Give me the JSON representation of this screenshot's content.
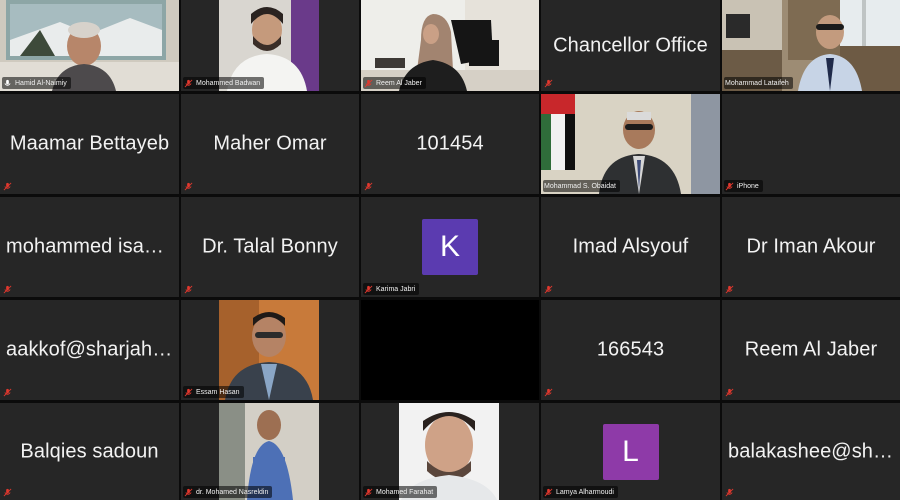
{
  "colors": {
    "tile_bg": "#262626",
    "active_border": "#b5d66a",
    "muted_mic": "#e0382e",
    "avatar_k": "#5b3bb0",
    "avatar_l": "#8e3aa8"
  },
  "tiles": [
    {
      "id": "hamid",
      "name": "Hamid Al-Naimiy",
      "type": "video",
      "mic": "on",
      "active": true
    },
    {
      "id": "badwan",
      "name": "Mohammed Badwan",
      "type": "video",
      "mic": "muted"
    },
    {
      "id": "reem1",
      "name": "Reem Al Jaber",
      "type": "video",
      "mic": "muted"
    },
    {
      "id": "chancellor",
      "display": "Chancellor Office",
      "type": "name",
      "mic": "muted"
    },
    {
      "id": "lataifeh",
      "name": "Mohammad Lataifeh",
      "type": "video",
      "mic": "on"
    },
    {
      "id": "maamar",
      "display": "Maamar Bettayeb",
      "type": "name",
      "mic": "muted"
    },
    {
      "id": "maher",
      "display": "Maher Omar",
      "type": "name",
      "mic": "muted"
    },
    {
      "id": "n101454",
      "display": "101454",
      "type": "name",
      "mic": "muted"
    },
    {
      "id": "obaidat",
      "name": "Mohammad S. Obaidat",
      "type": "video",
      "mic": "on"
    },
    {
      "id": "iphone",
      "name": "iPhone",
      "type": "blank",
      "mic": "muted"
    },
    {
      "id": "isam",
      "display": "mohammed isam...",
      "type": "name",
      "mic": "muted"
    },
    {
      "id": "talal",
      "display": "Dr. Talal Bonny",
      "type": "name",
      "mic": "muted"
    },
    {
      "id": "karima",
      "name": "Karima Jabri",
      "type": "avatar",
      "letter": "K",
      "mic": "muted"
    },
    {
      "id": "imad",
      "display": "Imad Alsyouf",
      "type": "name",
      "mic": "muted"
    },
    {
      "id": "iman",
      "display": "Dr Iman Akour",
      "type": "name",
      "mic": "muted"
    },
    {
      "id": "aakkof",
      "display": "aakkof@sharjah....",
      "type": "name",
      "mic": "muted"
    },
    {
      "id": "essam",
      "name": "Essam Hasan",
      "type": "video",
      "mic": "muted"
    },
    {
      "id": "blank1",
      "type": "blank-black",
      "mic": "none"
    },
    {
      "id": "n166543",
      "display": "166543",
      "type": "name",
      "mic": "muted"
    },
    {
      "id": "reem2",
      "display": "Reem Al Jaber",
      "type": "name",
      "mic": "muted"
    },
    {
      "id": "balqies",
      "display": "Balqies sadoun",
      "type": "name",
      "mic": "muted"
    },
    {
      "id": "nasreldin",
      "name": "dr. Mohamed Nasreldin",
      "type": "video",
      "mic": "muted"
    },
    {
      "id": "farahat",
      "name": "Mohamed Farahat",
      "type": "video",
      "mic": "muted"
    },
    {
      "id": "lamya",
      "name": "Lamya Alharmoudi",
      "type": "avatar",
      "letter": "L",
      "mic": "muted"
    },
    {
      "id": "balakashee",
      "display": "balakashee@sha...",
      "type": "name",
      "mic": "muted"
    }
  ]
}
